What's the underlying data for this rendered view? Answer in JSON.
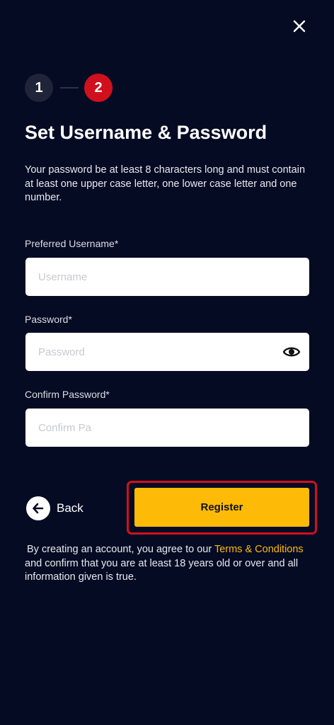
{
  "header": {
    "close_icon": "close-icon"
  },
  "stepper": {
    "steps": [
      "1",
      "2"
    ],
    "active_step": 2,
    "active_color": "#d0111d"
  },
  "page_title": "Set Username & Password",
  "description": "Your password be at least 8 characters long and must contain at least one upper case letter, one lower case letter and one number.",
  "form": {
    "username": {
      "label": "Preferred Username*",
      "placeholder": "Username",
      "value": ""
    },
    "password": {
      "label": "Password*",
      "placeholder": "Password",
      "value": "",
      "toggle_icon": "eye-icon"
    },
    "confirm_password": {
      "label": "Confirm Password*",
      "placeholder": "Confirm Pa",
      "value": ""
    }
  },
  "actions": {
    "back_label": "Back",
    "back_icon": "arrow-left-icon",
    "register_label": "Register",
    "register_color": "#fdbb08"
  },
  "legal": {
    "pre": "By creating an account, you agree to our",
    "link": "Terms & Conditions",
    "post": "and confirm that you are at least 18 years old or over and all information given is true."
  }
}
